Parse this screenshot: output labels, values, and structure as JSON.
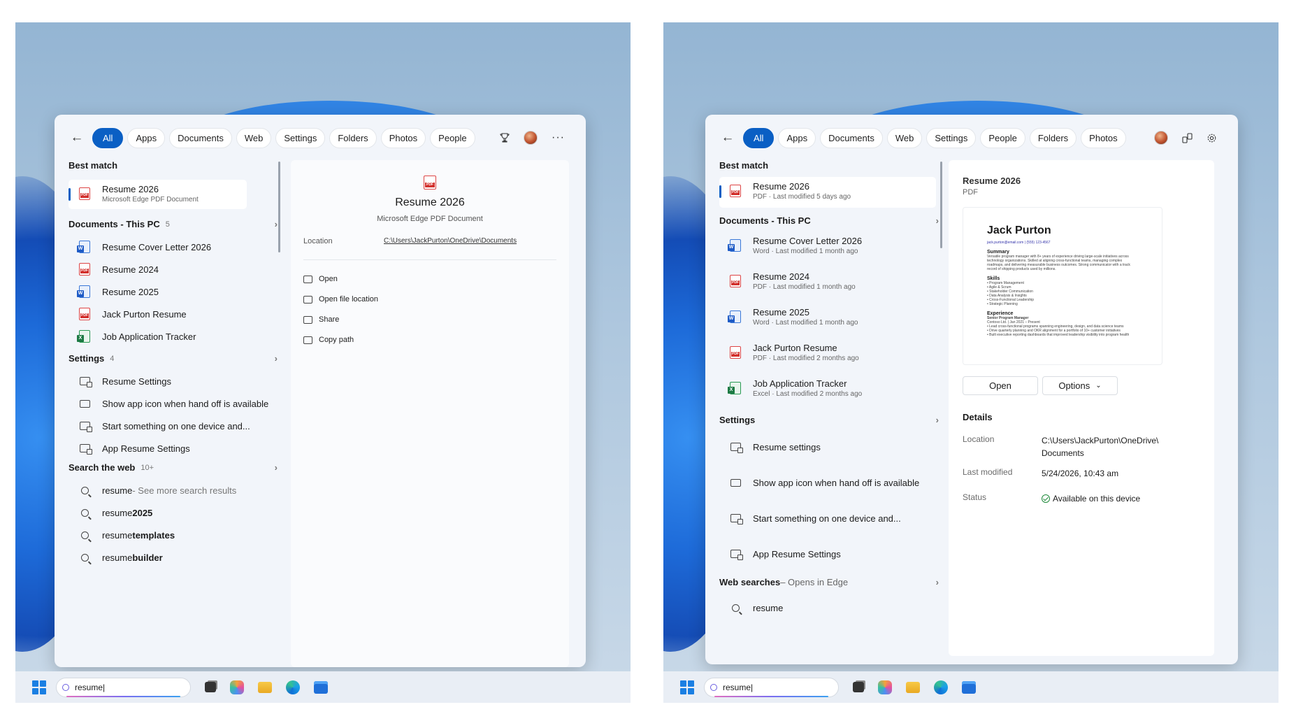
{
  "left": {
    "filters": [
      "All",
      "Apps",
      "Documents",
      "Web",
      "Settings",
      "Folders",
      "Photos",
      "People"
    ],
    "best_match": {
      "heading": "Best match",
      "title": "Resume 2026",
      "subtitle": "Microsoft Edge PDF Document"
    },
    "documents": {
      "heading": "Documents - This PC",
      "count": "5",
      "items": [
        {
          "label": "Resume Cover Letter 2026",
          "icon": "word-icon"
        },
        {
          "label": "Resume 2024",
          "icon": "pdf-icon"
        },
        {
          "label": "Resume 2025",
          "icon": "word-icon"
        },
        {
          "label": "Jack Purton Resume",
          "icon": "pdf-icon"
        },
        {
          "label": "Job Application Tracker",
          "icon": "excel-icon"
        }
      ]
    },
    "settings": {
      "heading": "Settings",
      "count": "4",
      "items": [
        "Resume Settings",
        "Show app icon when hand off is available",
        "Start something on one device and...",
        "App Resume Settings"
      ]
    },
    "web": {
      "heading": "Search the web",
      "count": "10+",
      "items": [
        {
          "prefix": "resume",
          "suffix": " - See more search results"
        },
        {
          "prefix": "resume ",
          "suffix": "2025"
        },
        {
          "prefix": "resume ",
          "suffix": "templates"
        },
        {
          "prefix": "resume ",
          "suffix": "builder"
        }
      ]
    },
    "detail": {
      "title": "Resume 2026",
      "subtitle": "Microsoft Edge PDF Document",
      "location_label": "Location",
      "location_value": "C:\\Users\\JackPurton\\OneDrive\\Documents",
      "actions": [
        "Open",
        "Open file location",
        "Share",
        "Copy path"
      ]
    },
    "taskbar_query": "resume|"
  },
  "right": {
    "filters": [
      "All",
      "Apps",
      "Documents",
      "Web",
      "Settings",
      "People",
      "Folders",
      "Photos"
    ],
    "best_match": {
      "heading": "Best match",
      "title": "Resume 2026",
      "subtitle": "PDF · Last modified 5 days ago"
    },
    "documents": {
      "heading": "Documents - This PC",
      "items": [
        {
          "title": "Resume Cover Letter 2026",
          "sub": "Word · Last modified 1 month ago",
          "icon": "word-icon"
        },
        {
          "title": "Resume 2024",
          "sub": "PDF · Last modified 1 month ago",
          "icon": "pdf-icon"
        },
        {
          "title": "Resume 2025",
          "sub": "Word · Last modified 1 month ago",
          "icon": "word-icon"
        },
        {
          "title": "Jack Purton Resume",
          "sub": "PDF · Last modified 2 months ago",
          "icon": "pdf-icon"
        },
        {
          "title": "Job Application Tracker",
          "sub": "Excel · Last modified 2 months ago",
          "icon": "excel-icon"
        }
      ]
    },
    "settings": {
      "heading": "Settings",
      "items": [
        "Resume settings",
        "Show app icon when hand off is available",
        "Start something on one device and...",
        "App Resume Settings"
      ]
    },
    "web": {
      "heading": "Web searches",
      "heading_suffix": " – Opens in Edge",
      "items": [
        "resume"
      ]
    },
    "detail": {
      "title": "Resume 2026",
      "type": "PDF",
      "preview": {
        "name": "Jack Purton",
        "contact": "jack.purton@email.com | (555) 123-4567",
        "summary_h": "Summary",
        "summary": "Versatile program manager with 8+ years of experience driving large-scale initiatives across technology organizations. Skilled at aligning cross-functional teams, managing complex roadmaps, and delivering measurable business outcomes. Strong communicator with a track record of shipping products used by millions.",
        "skills_h": "Skills",
        "skills": [
          "• Program Management",
          "• Agile & Scrum",
          "• Stakeholder Communication",
          "• Data Analysis & Insights",
          "• Cross-Functional Leadership",
          "• Strategic Planning"
        ],
        "exp_h": "Experience",
        "exp_role": "Senior Program Manager",
        "exp_co": "Contoso Ltd. | Jan 2021 – Present",
        "exp_items": [
          "• Lead cross-functional programs spanning engineering, design, and data science teams",
          "• Drive quarterly planning and OKR alignment for a portfolio of 10+ customer initiatives",
          "• Built executive reporting dashboards that improved leadership visibility into program health"
        ]
      },
      "open_label": "Open",
      "options_label": "Options",
      "details_heading": "Details",
      "location_label": "Location",
      "location_value": "C:\\Users\\JackPurton\\OneDrive\\ Documents",
      "modified_label": "Last modified",
      "modified_value": "5/24/2026, 10:43 am",
      "status_label": "Status",
      "status_value": "Available on this device"
    },
    "taskbar_query": "resume|"
  }
}
